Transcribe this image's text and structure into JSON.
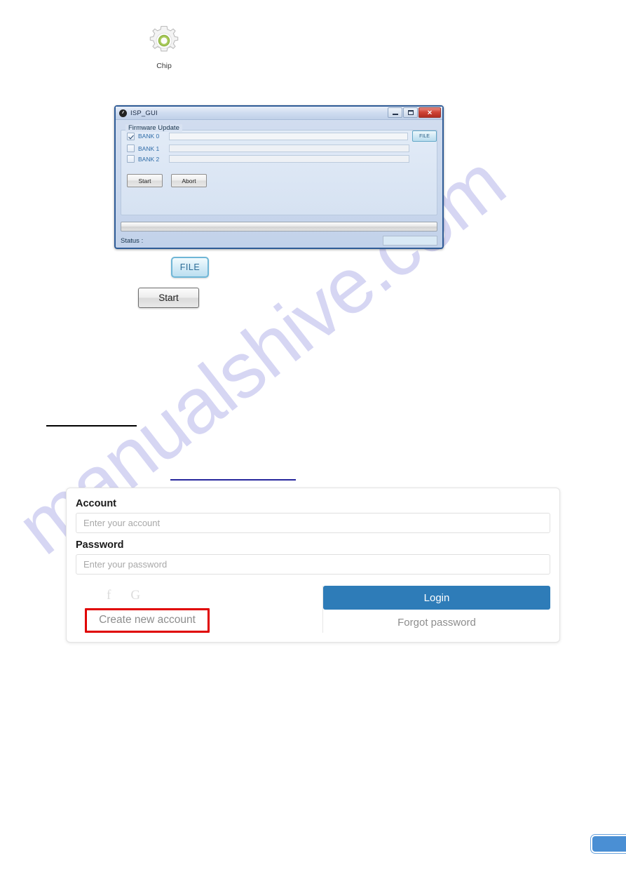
{
  "watermark": {
    "text": "manualshive.com"
  },
  "chip": {
    "icon": "gear-icon",
    "label": "Chip"
  },
  "isp_window": {
    "title": "ISP_GUI",
    "title_icon": "app-circle-icon",
    "window_controls": {
      "minimize": "–",
      "maximize": "▭",
      "close": "✕"
    },
    "group": {
      "legend": "Firmware Update",
      "banks": [
        {
          "label": "BANK 0",
          "checked": true,
          "value": ""
        },
        {
          "label": "BANK 1",
          "checked": false,
          "value": ""
        },
        {
          "label": "BANK 2",
          "checked": false,
          "value": ""
        }
      ],
      "file_button": "FILE",
      "start_button": "Start",
      "abort_button": "Abort"
    },
    "progress": {
      "percent": 0
    },
    "status": {
      "label": "Status :",
      "value": ""
    }
  },
  "callouts": {
    "file_button": "FILE",
    "start_button": "Start"
  },
  "login": {
    "account": {
      "label": "Account",
      "placeholder": "Enter your account",
      "value": ""
    },
    "password": {
      "label": "Password",
      "placeholder": "Enter your password",
      "value": ""
    },
    "social": [
      {
        "name": "facebook-icon",
        "glyph": "f"
      },
      {
        "name": "google-icon",
        "glyph": "G"
      }
    ],
    "create_account": "Create new account",
    "login_button": "Login",
    "forgot_password": "Forgot password",
    "highlight_color": "#e00000",
    "login_button_color": "#2e7cb8"
  },
  "corner_tab": {
    "color": "#4a8fd4"
  }
}
